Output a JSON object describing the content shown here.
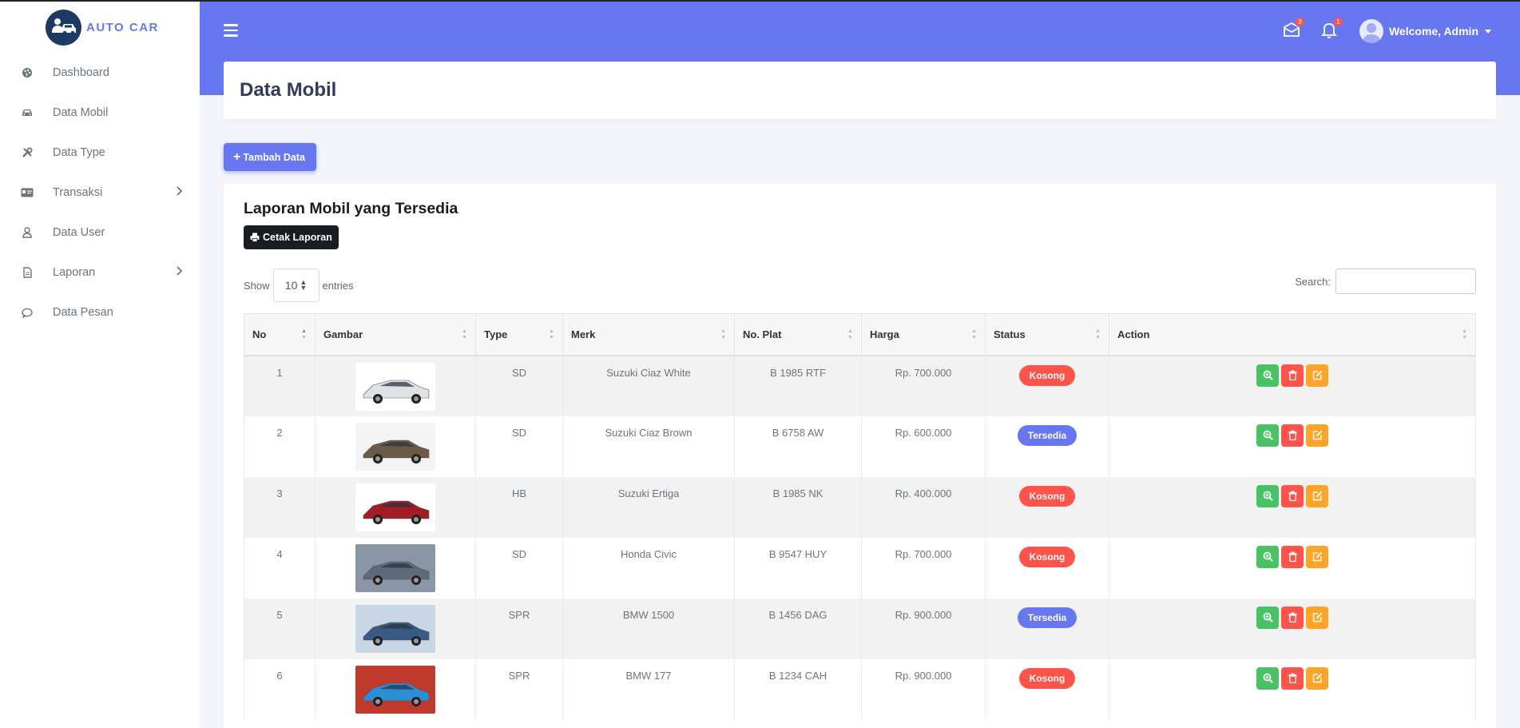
{
  "brand": {
    "name": "AUTO CAR"
  },
  "sidebar": {
    "items": [
      {
        "label": "Dashboard",
        "icon": "palette-icon"
      },
      {
        "label": "Data Mobil",
        "icon": "car-icon"
      },
      {
        "label": "Data Type",
        "icon": "tools-icon"
      },
      {
        "label": "Transaksi",
        "icon": "id-card-icon",
        "has_submenu": true
      },
      {
        "label": "Data User",
        "icon": "user-icon"
      },
      {
        "label": "Laporan",
        "icon": "file-icon",
        "has_submenu": true
      },
      {
        "label": "Data Pesan",
        "icon": "comment-icon"
      }
    ]
  },
  "topbar": {
    "messages_count": "3",
    "notifications_count": "1",
    "user_label": "Welcome, Admin"
  },
  "page": {
    "title": "Data Mobil",
    "add_button": "Tambah Data"
  },
  "report": {
    "title": "Laporan Mobil yang Tersedia",
    "print_button": "Cetak Laporan",
    "show_label": "Show",
    "entries_value": "10",
    "entries_label": "entries",
    "search_label": "Search:",
    "search_value": ""
  },
  "table": {
    "headers": [
      "No",
      "Gambar",
      "Type",
      "Merk",
      "No. Plat",
      "Harga",
      "Status",
      "Action"
    ],
    "rows": [
      {
        "no": "1",
        "type": "SD",
        "merk": "Suzuki Ciaz White",
        "plat": "B 1985 RTF",
        "harga": "Rp. 700.000",
        "status": "Kosong"
      },
      {
        "no": "2",
        "type": "SD",
        "merk": "Suzuki Ciaz Brown",
        "plat": "B 6758 AW",
        "harga": "Rp. 600.000",
        "status": "Tersedia"
      },
      {
        "no": "3",
        "type": "HB",
        "merk": "Suzuki Ertiga",
        "plat": "B 1985 NK",
        "harga": "Rp. 400.000",
        "status": "Kosong"
      },
      {
        "no": "4",
        "type": "SD",
        "merk": "Honda Civic",
        "plat": "B 9547 HUY",
        "harga": "Rp. 700.000",
        "status": "Kosong"
      },
      {
        "no": "5",
        "type": "SPR",
        "merk": "BMW 1500",
        "plat": "B 1456 DAG",
        "harga": "Rp. 900.000",
        "status": "Tersedia"
      },
      {
        "no": "6",
        "type": "SPR",
        "merk": "BMW 177",
        "plat": "B 1234 CAH",
        "harga": "Rp. 900.000",
        "status": "Kosong"
      }
    ]
  },
  "colors": {
    "primary": "#6777ef",
    "danger": "#fc544b",
    "success": "#47c363",
    "warning": "#ffa426",
    "dark": "#191d21"
  }
}
